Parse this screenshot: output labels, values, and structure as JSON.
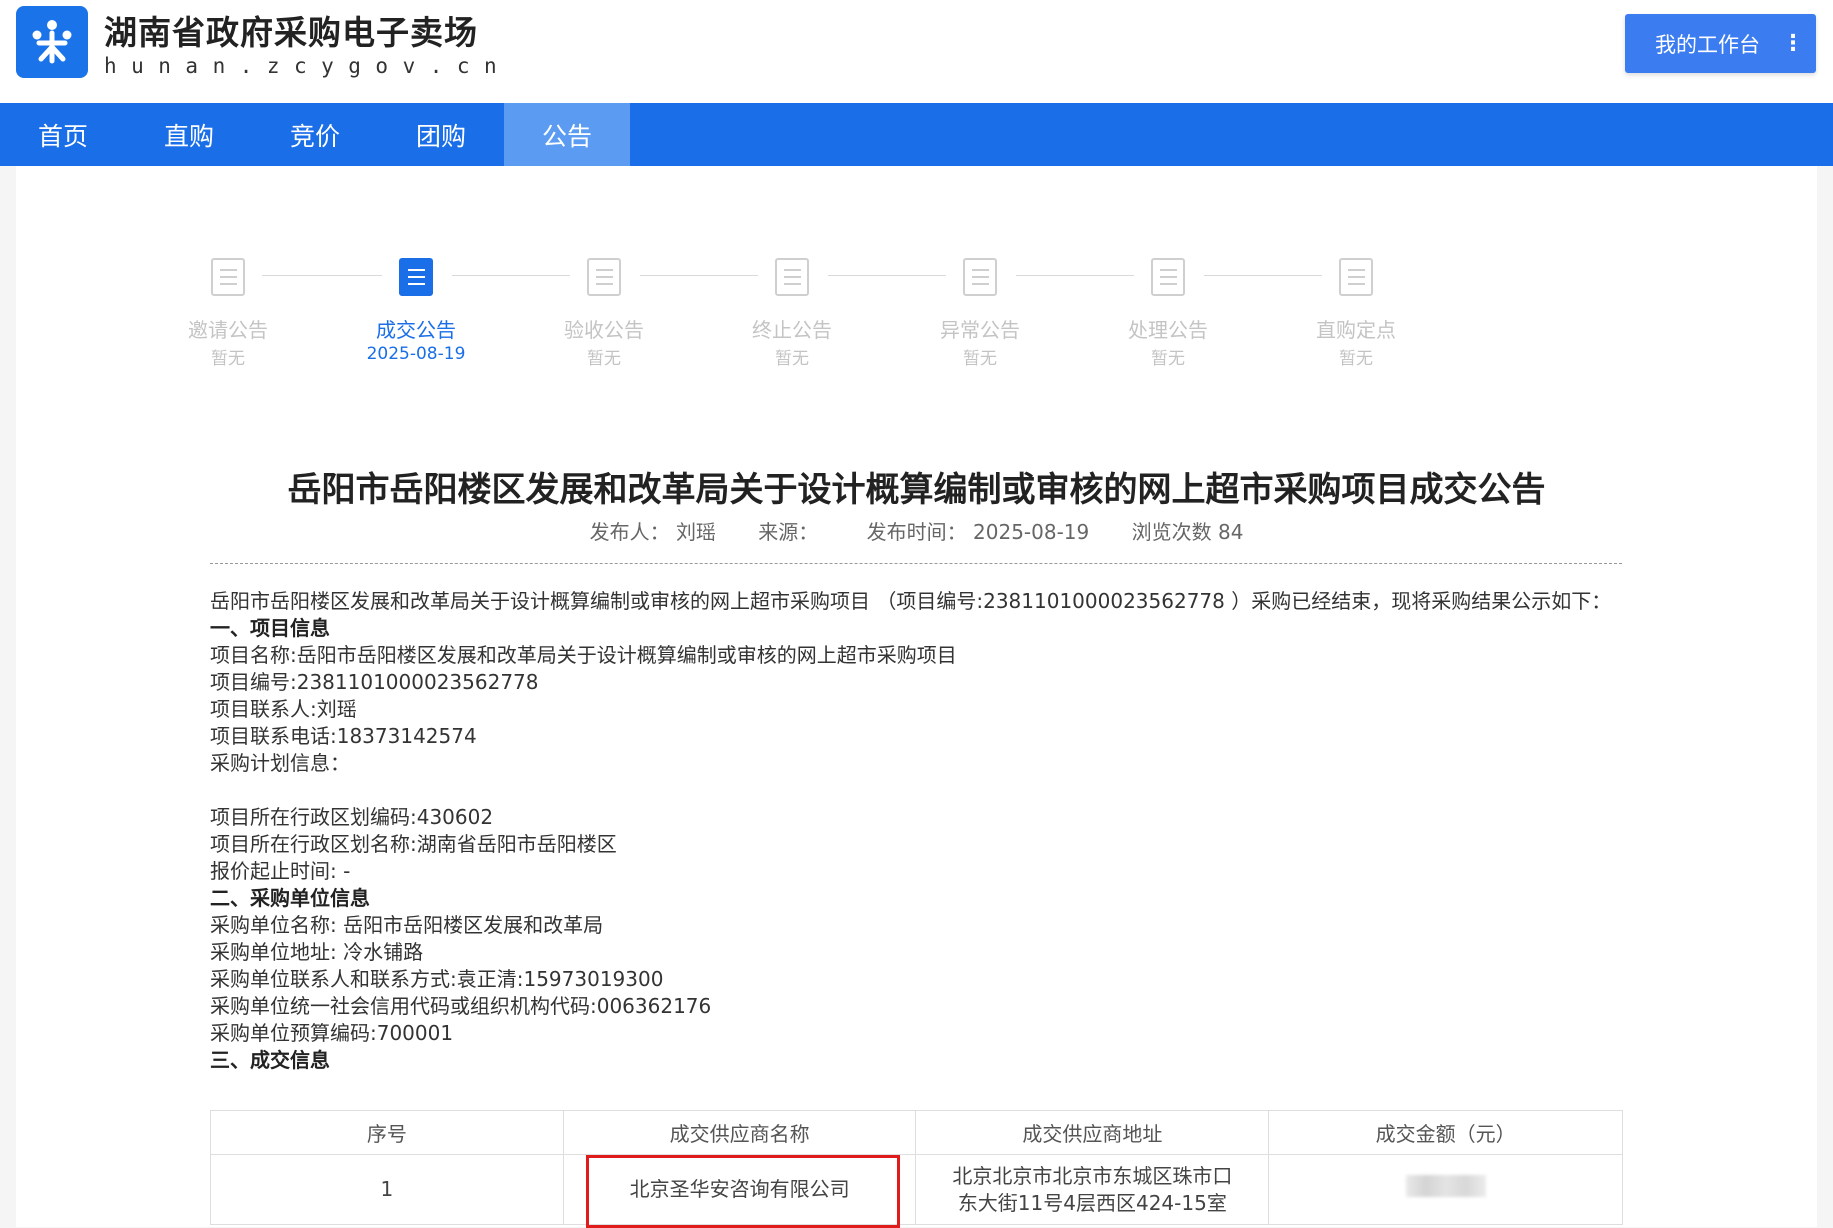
{
  "header": {
    "title": "湖南省政府采购电子卖场",
    "domain": "hunan.zcygov.cn",
    "workbench_label": "我的工作台",
    "more_symbol": "⋮"
  },
  "nav": {
    "items": [
      {
        "label": "首页"
      },
      {
        "label": "直购"
      },
      {
        "label": "竞价"
      },
      {
        "label": "团购"
      },
      {
        "label": "公告",
        "active": true
      }
    ]
  },
  "timeline": {
    "steps": [
      {
        "name": "邀请公告",
        "sub": "暂无"
      },
      {
        "name": "成交公告",
        "sub": "2025-08-19",
        "active": true
      },
      {
        "name": "验收公告",
        "sub": "暂无"
      },
      {
        "name": "终止公告",
        "sub": "暂无"
      },
      {
        "name": "异常公告",
        "sub": "暂无"
      },
      {
        "name": "处理公告",
        "sub": "暂无"
      },
      {
        "name": "直购定点",
        "sub": "暂无"
      }
    ]
  },
  "article": {
    "title": "岳阳市岳阳楼区发展和改革局关于设计概算编制或审核的网上超市采购项目成交公告",
    "publisher_label": "发布人：",
    "publisher": "刘瑶",
    "source_label": "来源：",
    "source": "",
    "publish_time_label": "发布时间：",
    "publish_time": "2025-08-19",
    "views_label": "浏览次数",
    "views": "84",
    "intro": "岳阳市岳阳楼区发展和改革局关于设计概算编制或审核的网上超市采购项目 （项目编号:2381101000023562778 ）采购已经结束，现将采购结果公示如下：",
    "section1": "一、项目信息",
    "project_name": "项目名称:岳阳市岳阳楼区发展和改革局关于设计概算编制或审核的网上超市采购项目",
    "project_no": "项目编号:2381101000023562778",
    "contact": "项目联系人:刘瑶",
    "phone": "项目联系电话:18373142574",
    "plan_info": "采购计划信息：",
    "region_code": "项目所在行政区划编码:430602",
    "region_name": "项目所在行政区划名称:湖南省岳阳市岳阳楼区",
    "quote_time": "报价起止时间: -",
    "section2": "二、采购单位信息",
    "buyer_name": "采购单位名称: 岳阳市岳阳楼区发展和改革局",
    "buyer_addr": "采购单位地址: 冷水铺路",
    "buyer_contact": "采购单位联系人和联系方式:袁正清:15973019300",
    "buyer_credit": "采购单位统一社会信用代码或组织机构代码:006362176",
    "buyer_budget": "采购单位预算编码:700001",
    "section3": "三、成交信息"
  },
  "deal_table": {
    "headers": [
      "序号",
      "成交供应商名称",
      "成交供应商地址",
      "成交金额（元）"
    ],
    "rows": [
      {
        "no": "1",
        "supplier": "北京圣华安咨询有限公司",
        "address": "北京北京市北京市东城区珠市口东大街11号4层西区424-15室"
      }
    ]
  },
  "colors": {
    "brand_blue": "#1a6ee8",
    "nav_active": "#5b9cf2",
    "highlight_red": "#e01b1b"
  }
}
